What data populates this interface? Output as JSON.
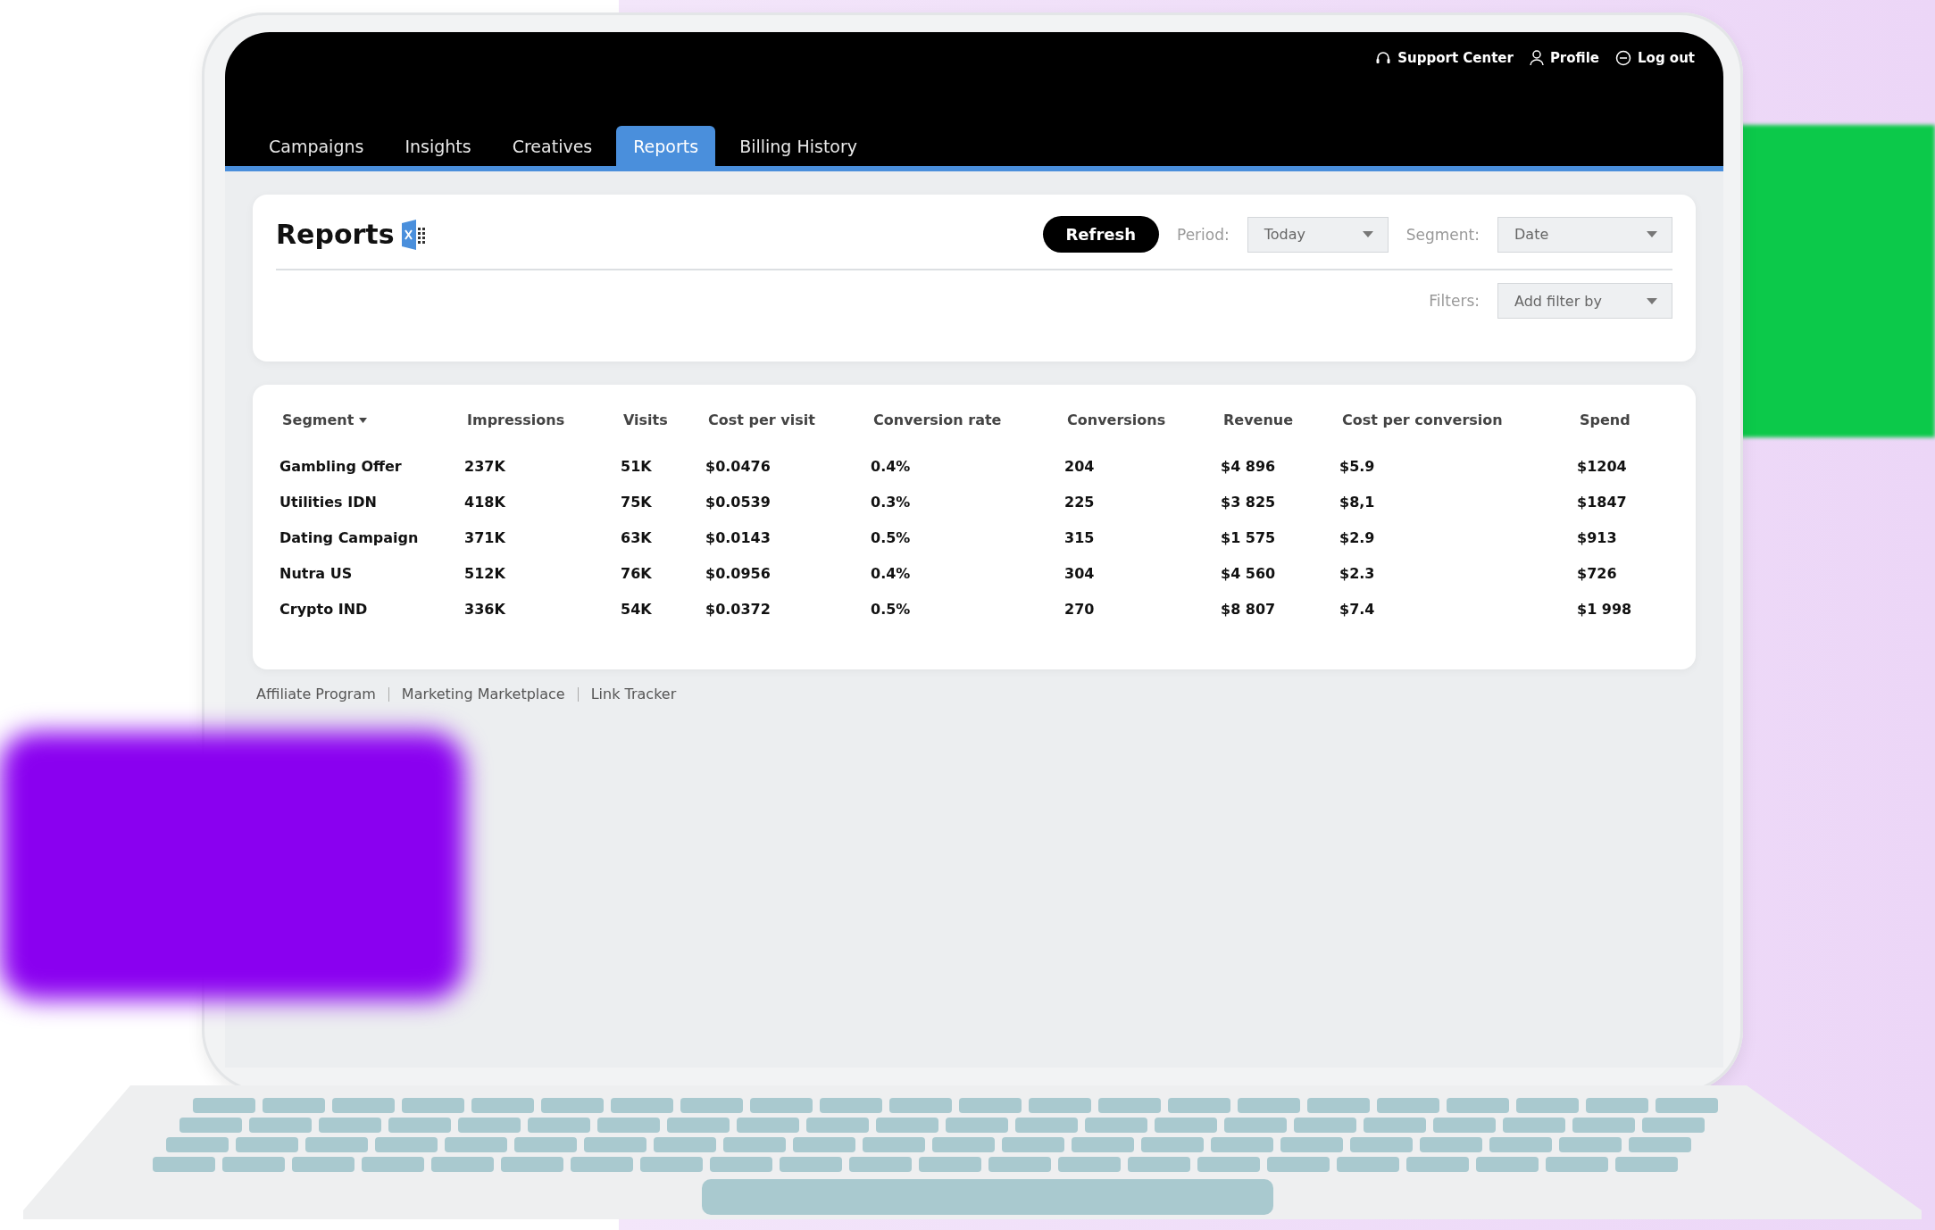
{
  "top_links": [
    {
      "label": "Support Center",
      "kind": "support"
    },
    {
      "label": "Profile",
      "kind": "profile"
    },
    {
      "label": "Log out",
      "kind": "logout"
    }
  ],
  "tabs": [
    {
      "label": "Campaigns",
      "selected": false
    },
    {
      "label": "Insights",
      "selected": false
    },
    {
      "label": "Creatives",
      "selected": false
    },
    {
      "label": "Reports",
      "selected": true
    },
    {
      "label": "Billing History",
      "selected": false
    }
  ],
  "reports_panel": {
    "title": "Reports",
    "refresh_button": "Refresh",
    "period": {
      "label": "Period:",
      "value": "Today"
    },
    "segment": {
      "label": "Segment:",
      "value": "Date"
    },
    "filters": {
      "label": "Filters:",
      "placeholder": "Add filter by"
    }
  },
  "table": {
    "columns": [
      {
        "label": "Segment",
        "sorted": true
      },
      {
        "label": "Impressions",
        "sorted": false
      },
      {
        "label": "Visits",
        "sorted": false
      },
      {
        "label": "Cost per visit",
        "sorted": false
      },
      {
        "label": "Conversion rate",
        "sorted": false
      },
      {
        "label": "Conversions",
        "sorted": false
      },
      {
        "label": "Revenue",
        "sorted": false
      },
      {
        "label": "Cost per conversion",
        "sorted": false
      },
      {
        "label": "Spend",
        "sorted": false
      }
    ],
    "rows": [
      [
        "Gambling Offer",
        "237K",
        "51K",
        "$0.0476",
        "0.4%",
        "204",
        "$4 896",
        "$5.9",
        "$1204"
      ],
      [
        "Utilities IDN",
        "418K",
        "75K",
        "$0.0539",
        "0.3%",
        "225",
        "$3 825",
        "$8,1",
        "$1847"
      ],
      [
        "Dating Campaign",
        "371K",
        "63K",
        "$0.0143",
        "0.5%",
        "315",
        "$1 575",
        "$2.9",
        "$913"
      ],
      [
        "Nutra US",
        "512K",
        "76K",
        "$0.0956",
        "0.4%",
        "304",
        "$4 560",
        "$2.3",
        "$726"
      ],
      [
        "Crypto IND",
        "336K",
        "54K",
        "$0.0372",
        "0.5%",
        "270",
        "$8 807",
        "$7.4",
        "$1 998"
      ]
    ]
  },
  "footer_links": [
    "Affiliate Program",
    "Marketing Marketplace",
    "Link Tracker"
  ]
}
